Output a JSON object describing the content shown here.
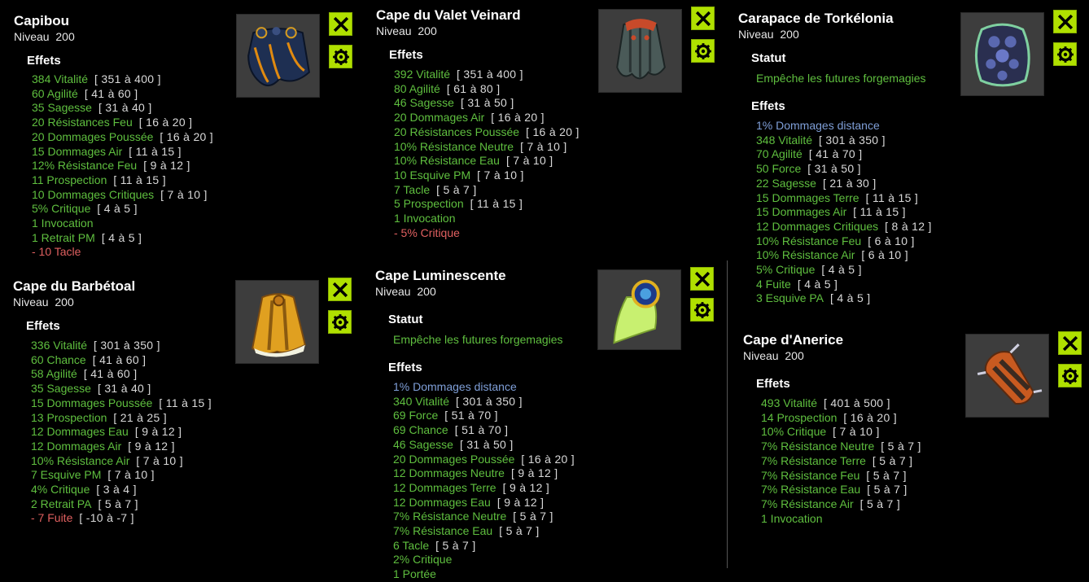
{
  "ui": {
    "level_label": "Niveau",
    "effects_label": "Effets",
    "status_label": "Statut"
  },
  "items": [
    {
      "name": "Capibou",
      "level": "200",
      "icon": "capibou-cloak-icon",
      "effects": [
        {
          "v": "384 Vitalité",
          "r": "[ 351 à 400 ]"
        },
        {
          "v": "60 Agilité",
          "r": "[ 41 à 60 ]"
        },
        {
          "v": "35 Sagesse",
          "r": "[ 31 à 40 ]"
        },
        {
          "v": "20 Résistances Feu",
          "r": "[ 16 à 20 ]"
        },
        {
          "v": "20 Dommages Poussée",
          "r": "[ 16 à 20 ]"
        },
        {
          "v": "15 Dommages Air",
          "r": "[ 11 à 15 ]"
        },
        {
          "v": "12% Résistance Feu",
          "r": "[ 9 à 12 ]"
        },
        {
          "v": "11 Prospection",
          "r": "[ 11 à 15 ]"
        },
        {
          "v": "10 Dommages Critiques",
          "r": "[ 7 à 10 ]"
        },
        {
          "v": "5% Critique",
          "r": "[ 4 à 5 ]"
        },
        {
          "v": "1 Invocation",
          "r": ""
        },
        {
          "v": "1 Retrait PM",
          "r": "[ 4 à 5 ]"
        },
        {
          "v": "- 10 Tacle",
          "r": "",
          "neg": true
        }
      ]
    },
    {
      "name": "Cape du Valet Veinard",
      "level": "200",
      "icon": "valet-cloak-icon",
      "effects": [
        {
          "v": "392 Vitalité",
          "r": "[ 351 à 400 ]"
        },
        {
          "v": "80 Agilité",
          "r": "[ 61 à 80 ]"
        },
        {
          "v": "46 Sagesse",
          "r": "[ 31 à 50 ]"
        },
        {
          "v": "20 Dommages Air",
          "r": "[ 16 à 20 ]"
        },
        {
          "v": "20 Résistances Poussée",
          "r": "[ 16 à 20 ]"
        },
        {
          "v": "10% Résistance Neutre",
          "r": "[ 7 à 10 ]"
        },
        {
          "v": "10% Résistance Eau",
          "r": "[ 7 à 10 ]"
        },
        {
          "v": "10 Esquive PM",
          "r": "[ 7 à 10 ]"
        },
        {
          "v": "7 Tacle",
          "r": "[ 5 à 7 ]"
        },
        {
          "v": "5 Prospection",
          "r": "[ 11 à 15 ]"
        },
        {
          "v": "1 Invocation",
          "r": ""
        },
        {
          "v": "- 5% Critique",
          "r": "",
          "neg": true
        }
      ]
    },
    {
      "name": "Carapace de Torkélonia",
      "level": "200",
      "icon": "torkelonia-shell-icon",
      "status": "Empêche les futures forgemagies",
      "effects": [
        {
          "v": "1% Dommages distance",
          "r": "",
          "blue": true
        },
        {
          "v": "348 Vitalité",
          "r": "[ 301 à 350 ]"
        },
        {
          "v": "70 Agilité",
          "r": "[ 41 à 70 ]"
        },
        {
          "v": "50 Force",
          "r": "[ 31 à 50 ]"
        },
        {
          "v": "22 Sagesse",
          "r": "[ 21 à 30 ]"
        },
        {
          "v": "15 Dommages Terre",
          "r": "[ 11 à 15 ]"
        },
        {
          "v": "15 Dommages Air",
          "r": "[ 11 à 15 ]"
        },
        {
          "v": "12 Dommages Critiques",
          "r": "[ 8 à 12 ]"
        },
        {
          "v": "10% Résistance Feu",
          "r": "[ 6 à 10 ]"
        },
        {
          "v": "10% Résistance Air",
          "r": "[ 6 à 10 ]"
        },
        {
          "v": "5% Critique",
          "r": "[ 4 à 5 ]"
        },
        {
          "v": "4 Fuite",
          "r": "[ 4 à 5 ]"
        },
        {
          "v": "3 Esquive PA",
          "r": "[ 4 à 5 ]"
        }
      ]
    },
    {
      "name": "Cape du Barbétoal",
      "level": "200",
      "icon": "barbetoal-cloak-icon",
      "effects": [
        {
          "v": "336 Vitalité",
          "r": "[ 301 à 350 ]"
        },
        {
          "v": "60 Chance",
          "r": "[ 41 à 60 ]"
        },
        {
          "v": "58 Agilité",
          "r": "[ 41 à 60 ]"
        },
        {
          "v": "35 Sagesse",
          "r": "[ 31 à 40 ]"
        },
        {
          "v": "15 Dommages Poussée",
          "r": "[ 11 à 15 ]"
        },
        {
          "v": "13 Prospection",
          "r": "[ 21 à 25 ]"
        },
        {
          "v": "12 Dommages Eau",
          "r": "[ 9 à 12 ]"
        },
        {
          "v": "12 Dommages Air",
          "r": "[ 9 à 12 ]"
        },
        {
          "v": "10% Résistance Air",
          "r": "[ 7 à 10 ]"
        },
        {
          "v": "7 Esquive PM",
          "r": "[ 7 à 10 ]"
        },
        {
          "v": "4% Critique",
          "r": "[ 3 à 4 ]"
        },
        {
          "v": "2 Retrait PA",
          "r": "[ 5 à 7 ]"
        },
        {
          "v": "- 7 Fuite",
          "r": "[ -10 à -7 ]",
          "neg": true
        }
      ]
    },
    {
      "name": "Cape Luminescente",
      "level": "200",
      "icon": "luminescent-cloak-icon",
      "status": "Empêche les futures forgemagies",
      "effects": [
        {
          "v": "1% Dommages distance",
          "r": "",
          "blue": true
        },
        {
          "v": "340 Vitalité",
          "r": "[ 301 à 350 ]"
        },
        {
          "v": "69 Force",
          "r": "[ 51 à 70 ]"
        },
        {
          "v": "69 Chance",
          "r": "[ 51 à 70 ]"
        },
        {
          "v": "46 Sagesse",
          "r": "[ 31 à 50 ]"
        },
        {
          "v": "20 Dommages Poussée",
          "r": "[ 16 à 20 ]"
        },
        {
          "v": "12 Dommages Neutre",
          "r": "[ 9 à 12 ]"
        },
        {
          "v": "12 Dommages Terre",
          "r": "[ 9 à 12 ]"
        },
        {
          "v": "12 Dommages Eau",
          "r": "[ 9 à 12 ]"
        },
        {
          "v": "7% Résistance Neutre",
          "r": "[ 5 à 7 ]"
        },
        {
          "v": "7% Résistance Eau",
          "r": "[ 5 à 7 ]"
        },
        {
          "v": "6 Tacle",
          "r": "[ 5 à 7 ]"
        },
        {
          "v": "2% Critique",
          "r": ""
        },
        {
          "v": "1 Portée",
          "r": ""
        }
      ]
    },
    {
      "name": "Cape d'Anerice",
      "level": "200",
      "icon": "anerice-cloak-icon",
      "effects": [
        {
          "v": "493 Vitalité",
          "r": "[ 401 à 500 ]"
        },
        {
          "v": "14 Prospection",
          "r": "[ 16 à 20 ]"
        },
        {
          "v": "10% Critique",
          "r": "[ 7 à 10 ]"
        },
        {
          "v": "7% Résistance Neutre",
          "r": "[ 5 à 7 ]"
        },
        {
          "v": "7% Résistance Terre",
          "r": "[ 5 à 7 ]"
        },
        {
          "v": "7% Résistance Feu",
          "r": "[ 5 à 7 ]"
        },
        {
          "v": "7% Résistance Eau",
          "r": "[ 5 à 7 ]"
        },
        {
          "v": "7% Résistance Air",
          "r": "[ 5 à 7 ]"
        },
        {
          "v": "1 Invocation",
          "r": ""
        }
      ]
    }
  ]
}
